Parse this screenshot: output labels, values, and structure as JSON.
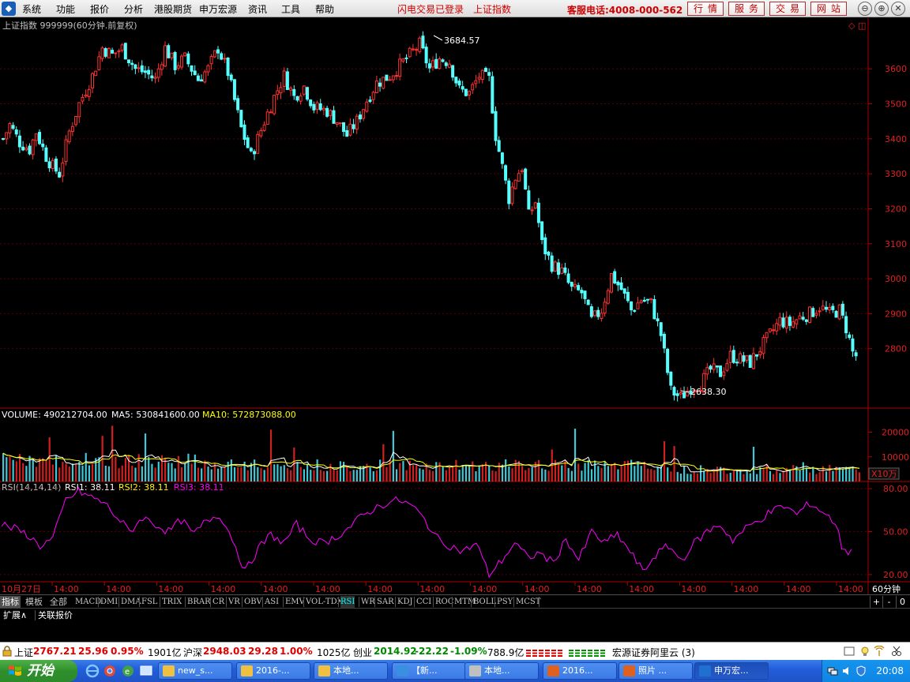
{
  "menu": {
    "items": [
      "系统",
      "功能",
      "报价",
      "分析",
      "港股期货",
      "申万宏源",
      "资讯",
      "工具",
      "帮助"
    ],
    "status": [
      "闪电交易已登录",
      "上证指数"
    ],
    "hotline": "客服电话:4008-000-562",
    "buttons": [
      "行情",
      "服务",
      "交易",
      "网站"
    ]
  },
  "chart_header": {
    "title": "上证指数 999999(60分钟.前复权)"
  },
  "price_labels": {
    "high": "3684.57",
    "low": "2638.30"
  },
  "volume_header": {
    "volume": "VOLUME: 490212704.00",
    "ma5": "MA5: 530841600.00",
    "ma10": "MA10: 572873088.00",
    "unit": "X10万"
  },
  "rsi_header": {
    "name": "RSI(14,14,14)",
    "rsi1": "RSI1: 38.11",
    "rsi2": "RSI2: 38.11",
    "rsi3": "RSI3: 38.11"
  },
  "x_axis": {
    "first": "10月27日",
    "tick": "14:00",
    "period": "60分钟"
  },
  "colors": {
    "up": "#ff3232",
    "down": "#54ffff",
    "ma5": "#ffffff",
    "ma10": "#ffff00",
    "rsi": "#ff00ff",
    "grid": "#b00000"
  },
  "chart_data": [
    {
      "type": "candlestick",
      "title": "上证指数 999999(60分钟.前复权)",
      "y_ticks": [
        2800,
        2900,
        3000,
        3100,
        3200,
        3300,
        3400,
        3500,
        3600
      ],
      "ylim": [
        2630,
        3745
      ],
      "high_label": 3684.57,
      "low_label": 2638.3,
      "close_path": [
        [
          0,
          3400
        ],
        [
          2,
          3440
        ],
        [
          5,
          3390
        ],
        [
          8,
          3370
        ],
        [
          10,
          3420
        ],
        [
          13,
          3350
        ],
        [
          15,
          3320
        ],
        [
          17,
          3300
        ],
        [
          20,
          3420
        ],
        [
          23,
          3500
        ],
        [
          27,
          3580
        ],
        [
          30,
          3660
        ],
        [
          33,
          3640
        ],
        [
          36,
          3660
        ],
        [
          40,
          3600
        ],
        [
          43,
          3590
        ],
        [
          46,
          3570
        ],
        [
          49,
          3660
        ],
        [
          52,
          3610
        ],
        [
          55,
          3630
        ],
        [
          59,
          3570
        ],
        [
          62,
          3600
        ],
        [
          65,
          3660
        ],
        [
          68,
          3590
        ],
        [
          72,
          3430
        ],
        [
          75,
          3350
        ],
        [
          79,
          3450
        ],
        [
          82,
          3520
        ],
        [
          85,
          3580
        ],
        [
          88,
          3520
        ],
        [
          91,
          3550
        ],
        [
          94,
          3490
        ],
        [
          98,
          3480
        ],
        [
          101,
          3450
        ],
        [
          104,
          3410
        ],
        [
          107,
          3450
        ],
        [
          110,
          3510
        ],
        [
          113,
          3560
        ],
        [
          117,
          3580
        ],
        [
          120,
          3610
        ],
        [
          123,
          3640
        ],
        [
          126,
          3670
        ],
        [
          129,
          3600
        ],
        [
          132,
          3630
        ],
        [
          135,
          3620
        ],
        [
          138,
          3540
        ],
        [
          141,
          3530
        ],
        [
          144,
          3580
        ],
        [
          147,
          3570
        ],
        [
          149,
          3410
        ],
        [
          151,
          3320
        ],
        [
          153,
          3230
        ],
        [
          155,
          3290
        ],
        [
          157,
          3320
        ],
        [
          159,
          3180
        ],
        [
          161,
          3220
        ],
        [
          163,
          3100
        ],
        [
          166,
          3040
        ],
        [
          169,
          3020
        ],
        [
          172,
          2970
        ],
        [
          175,
          2960
        ],
        [
          178,
          2880
        ],
        [
          181,
          2910
        ],
        [
          184,
          3010
        ],
        [
          187,
          2970
        ],
        [
          190,
          2910
        ],
        [
          193,
          2940
        ],
        [
          196,
          2930
        ],
        [
          199,
          2840
        ],
        [
          202,
          2680
        ],
        [
          205,
          2660
        ],
        [
          208,
          2690
        ],
        [
          211,
          2700
        ],
        [
          214,
          2740
        ],
        [
          217,
          2730
        ],
        [
          220,
          2780
        ],
        [
          223,
          2770
        ],
        [
          226,
          2760
        ],
        [
          229,
          2800
        ],
        [
          232,
          2840
        ],
        [
          235,
          2880
        ],
        [
          238,
          2870
        ],
        [
          241,
          2890
        ],
        [
          244,
          2900
        ],
        [
          247,
          2920
        ],
        [
          250,
          2900
        ],
        [
          253,
          2910
        ],
        [
          255,
          2860
        ],
        [
          257,
          2790
        ],
        [
          259,
          2770
        ]
      ]
    },
    {
      "type": "bar",
      "title": "VOLUME",
      "y_ticks": [
        10000,
        20000
      ],
      "unit": "X10万",
      "series": [
        {
          "name": "VOLUME",
          "values": [
            4902
          ]
        },
        {
          "name": "MA5",
          "values": [
            5308
          ]
        },
        {
          "name": "MA10",
          "values": [
            5729
          ]
        }
      ]
    },
    {
      "type": "line",
      "title": "RSI(14,14,14)",
      "y_ticks": [
        20,
        50,
        80
      ],
      "ylim": [
        15,
        85
      ],
      "path": [
        [
          0,
          55
        ],
        [
          4,
          52
        ],
        [
          8,
          48
        ],
        [
          12,
          40
        ],
        [
          16,
          45
        ],
        [
          20,
          72
        ],
        [
          24,
          78
        ],
        [
          28,
          74
        ],
        [
          32,
          70
        ],
        [
          36,
          60
        ],
        [
          40,
          50
        ],
        [
          44,
          60
        ],
        [
          48,
          55
        ],
        [
          52,
          50
        ],
        [
          56,
          58
        ],
        [
          60,
          48
        ],
        [
          64,
          58
        ],
        [
          68,
          62
        ],
        [
          72,
          45
        ],
        [
          76,
          22
        ],
        [
          80,
          38
        ],
        [
          84,
          48
        ],
        [
          88,
          42
        ],
        [
          92,
          55
        ],
        [
          96,
          45
        ],
        [
          100,
          42
        ],
        [
          104,
          46
        ],
        [
          108,
          52
        ],
        [
          112,
          60
        ],
        [
          116,
          66
        ],
        [
          120,
          70
        ],
        [
          124,
          72
        ],
        [
          128,
          68
        ],
        [
          132,
          58
        ],
        [
          136,
          45
        ],
        [
          140,
          40
        ],
        [
          144,
          36
        ],
        [
          148,
          42
        ],
        [
          152,
          20
        ],
        [
          156,
          30
        ],
        [
          160,
          42
        ],
        [
          164,
          32
        ],
        [
          168,
          35
        ],
        [
          172,
          28
        ],
        [
          176,
          45
        ],
        [
          180,
          30
        ],
        [
          184,
          50
        ],
        [
          188,
          42
        ],
        [
          192,
          48
        ],
        [
          196,
          36
        ],
        [
          200,
          22
        ],
        [
          204,
          34
        ],
        [
          208,
          40
        ],
        [
          212,
          30
        ],
        [
          216,
          42
        ],
        [
          220,
          50
        ],
        [
          224,
          55
        ],
        [
          228,
          44
        ],
        [
          232,
          52
        ],
        [
          236,
          58
        ],
        [
          240,
          64
        ],
        [
          244,
          68
        ],
        [
          248,
          62
        ],
        [
          252,
          70
        ],
        [
          256,
          64
        ],
        [
          260,
          56
        ],
        [
          262,
          40
        ],
        [
          264,
          36
        ],
        [
          266,
          38
        ]
      ]
    }
  ],
  "indicator_tabs": {
    "first": [
      "指标",
      "模板",
      "全部"
    ],
    "items": [
      "MACD",
      "DMI",
      "DMA",
      "FSL",
      "TRIX",
      "BRAR",
      "CR",
      "VR",
      "OBV",
      "ASI",
      "EMV",
      "VOL-TDX",
      "RSI",
      "WR",
      "SAR",
      "KDJ",
      "CCI",
      "ROC",
      "MTM",
      "BOLL",
      "PSY",
      "MCST"
    ],
    "active": "RSI",
    "right": [
      "+",
      "-",
      "0"
    ]
  },
  "second_tabs": [
    "扩展∧",
    "关联报价"
  ],
  "status_bar": {
    "sh_label": "上证",
    "sh_value": "2767.21",
    "sh_change": "25.96",
    "sh_pct": "0.95%",
    "sh_amount": "1901亿",
    "hs_label": "沪深",
    "hs_value": "2948.03",
    "hs_change": "29.28",
    "hs_pct": "1.00%",
    "hs_amount": "1025亿",
    "cy_label": "创业",
    "cy_value": "2014.92",
    "cy_change": "-22.22",
    "cy_pct": "-1.09%",
    "cy_amount": "788.9亿",
    "broker": "宏源证券阿里云 (3)"
  },
  "taskbar": {
    "start": "开始",
    "tasks": [
      "new_s...",
      "2016-...",
      "本地...",
      "【新...",
      "本地...",
      "2016...",
      "照片 ...",
      "申万宏..."
    ],
    "clock": "20:08"
  }
}
